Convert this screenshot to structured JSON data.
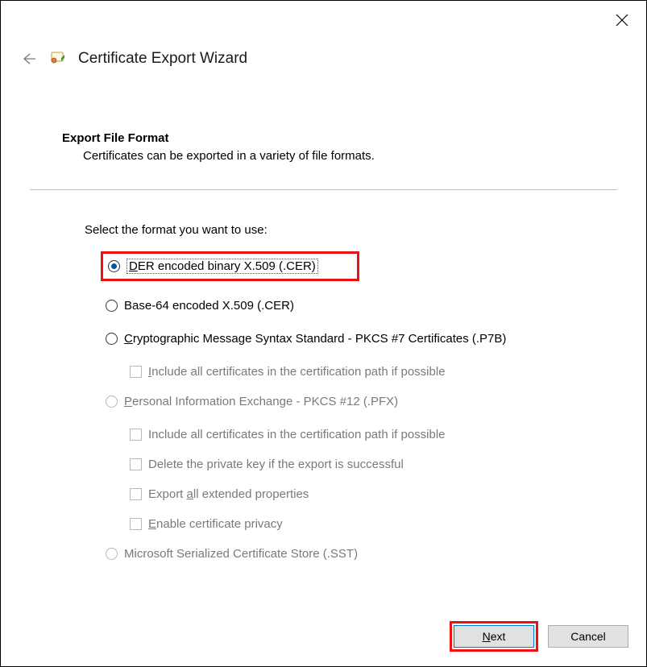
{
  "window": {
    "title": "Certificate Export Wizard"
  },
  "page": {
    "heading": "Export File Format",
    "subheading": "Certificates can be exported in a variety of file formats.",
    "prompt": "Select the format you want to use:"
  },
  "options": {
    "der_pre": "D",
    "der_post": "ER encoded binary X.509 (.CER)",
    "b64": "Base-64 encoded X.509 (.CER)",
    "p7b_pre": "C",
    "p7b_post": "ryptographic Message Syntax Standard - PKCS #7 Certificates (.P7B)",
    "p7b_include_pre": "I",
    "p7b_include_post": "nclude all certificates in the certification path if possible",
    "pfx_pre": "P",
    "pfx_post": "ersonal Information Exchange - PKCS #12 (.PFX)",
    "pfx_include": "Include all certificates in the certification path if possible",
    "pfx_delete": "Delete the private key if the export is successful",
    "pfx_ext_pre": "Export ",
    "pfx_ext_mn": "a",
    "pfx_ext_post": "ll extended properties",
    "pfx_priv_pre": "E",
    "pfx_priv_post": "nable certificate privacy",
    "sst": "Microsoft Serialized Certificate Store (.SST)"
  },
  "buttons": {
    "next_pre": "N",
    "next_post": "ext",
    "cancel": "Cancel"
  }
}
